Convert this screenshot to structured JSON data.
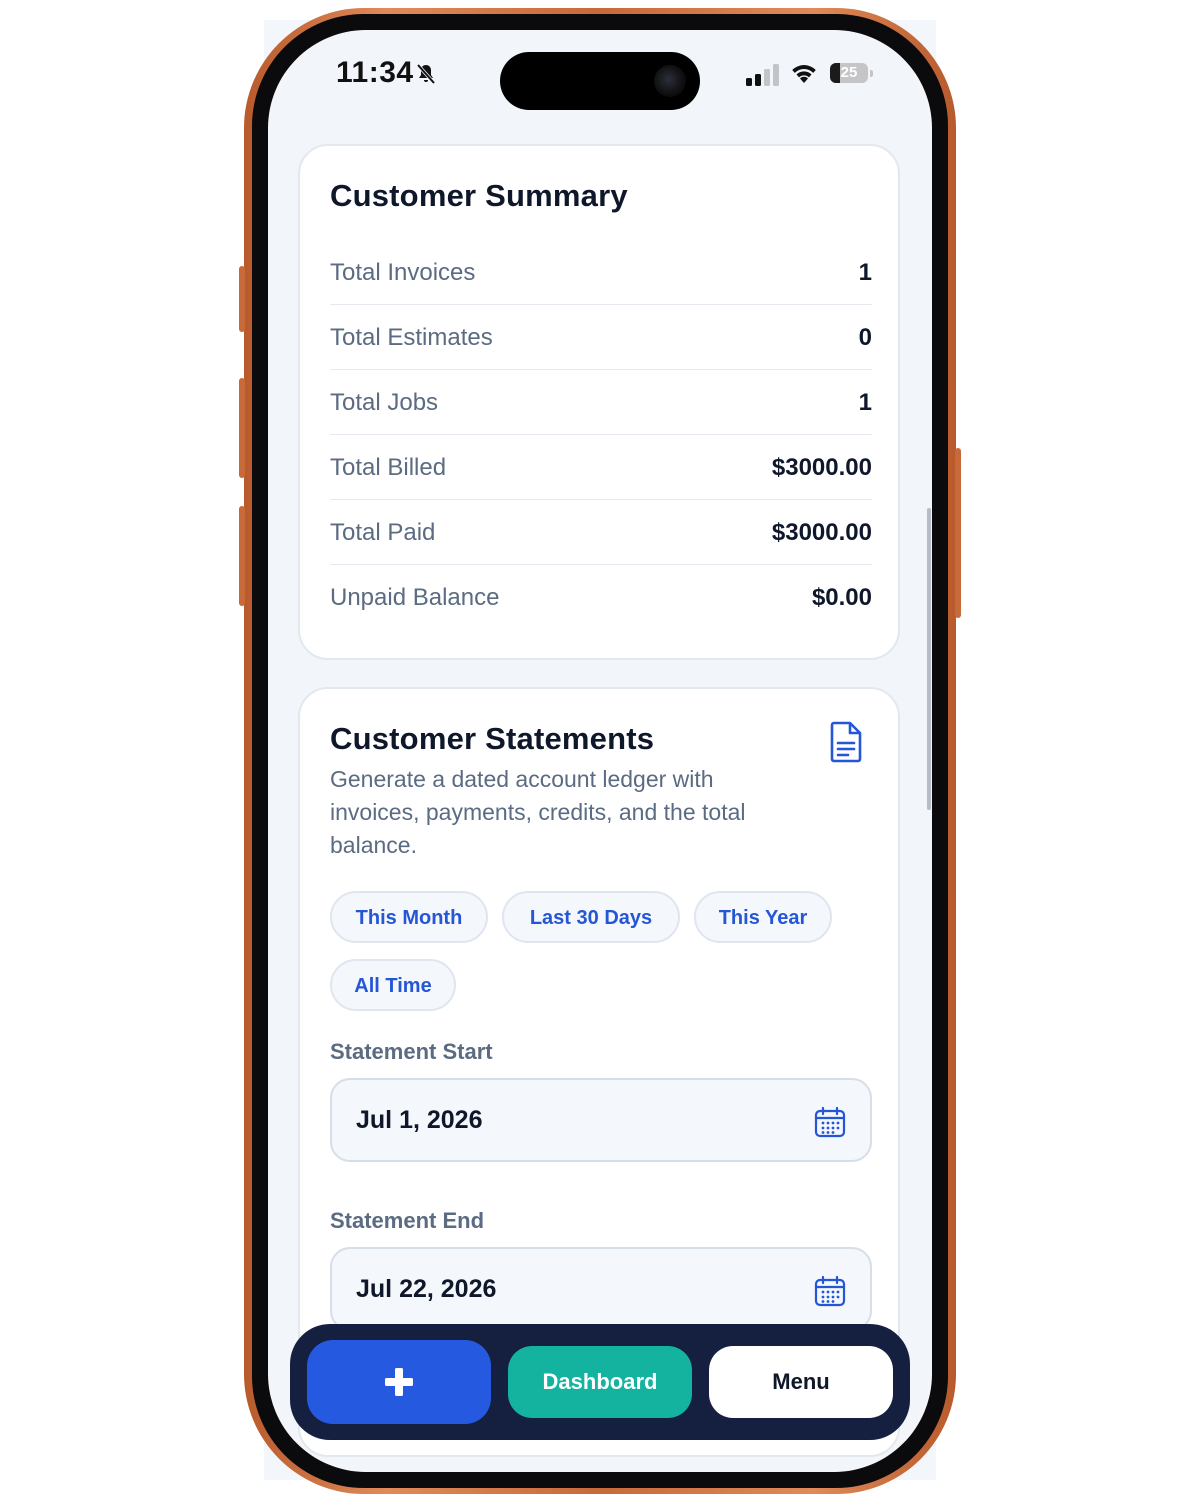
{
  "status_bar": {
    "time": "11:34",
    "battery": "25",
    "battery_level": 0.25
  },
  "summary": {
    "title": "Customer Summary",
    "rows": [
      {
        "label": "Total Invoices",
        "value": "1"
      },
      {
        "label": "Total Estimates",
        "value": "0"
      },
      {
        "label": "Total Jobs",
        "value": "1"
      },
      {
        "label": "Total Billed",
        "value": "$3000.00"
      },
      {
        "label": "Total Paid",
        "value": "$3000.00"
      },
      {
        "label": "Unpaid Balance",
        "value": "$0.00"
      }
    ]
  },
  "statements": {
    "title": "Customer Statements",
    "description": "Generate a dated account ledger with invoices, payments, credits, and the total balance.",
    "icon": "document-icon",
    "chips": [
      "This Month",
      "Last 30 Days",
      "This Year",
      "All Time"
    ],
    "start_label": "Statement Start",
    "start_value": "Jul 1, 2026",
    "end_label": "Statement End",
    "end_value": "Jul 22, 2026"
  },
  "bottom_nav": {
    "add_icon": "plus-icon",
    "dashboard_label": "Dashboard",
    "menu_label": "Menu"
  },
  "colors": {
    "accent_blue": "#2459e0",
    "teal": "#14b3a0",
    "nav_bg": "#152040",
    "frame": "#c8693a"
  }
}
